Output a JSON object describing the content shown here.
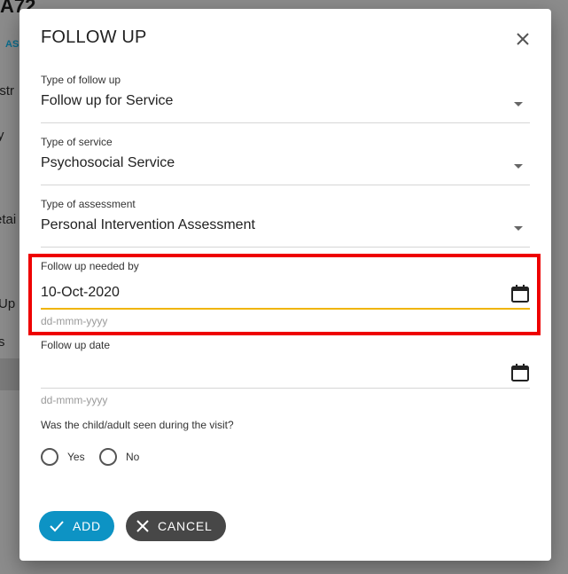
{
  "background": {
    "title": "A72",
    "ass_label": "AS",
    "fragments": [
      "istr",
      "y",
      "etai",
      "Up",
      "s"
    ]
  },
  "dialog": {
    "title": "FOLLOW UP",
    "close_icon": "close-icon",
    "fields": {
      "type_of_follow_up": {
        "label": "Type of follow up",
        "value": "Follow up for Service"
      },
      "type_of_service": {
        "label": "Type of service",
        "value": "Psychosocial Service"
      },
      "type_of_assessment": {
        "label": "Type of assessment",
        "value": "Personal Intervention Assessment"
      },
      "follow_up_needed_by": {
        "label": "Follow up needed by",
        "value": "10-Oct-2020",
        "hint": "dd-mmm-yyyy"
      },
      "follow_up_date": {
        "label": "Follow up date",
        "value": "",
        "hint": "dd-mmm-yyyy"
      }
    },
    "question": {
      "label": "Was the child/adult seen during the visit?",
      "options": [
        "Yes",
        "No"
      ],
      "selected": null
    },
    "buttons": {
      "add": "ADD",
      "cancel": "CANCEL"
    }
  },
  "colors": {
    "accent": "#0d93c4",
    "cancel": "#474747",
    "focus_underline": "#f0b400",
    "highlight": "#ee0000",
    "overlay": "#8c8c8c"
  }
}
